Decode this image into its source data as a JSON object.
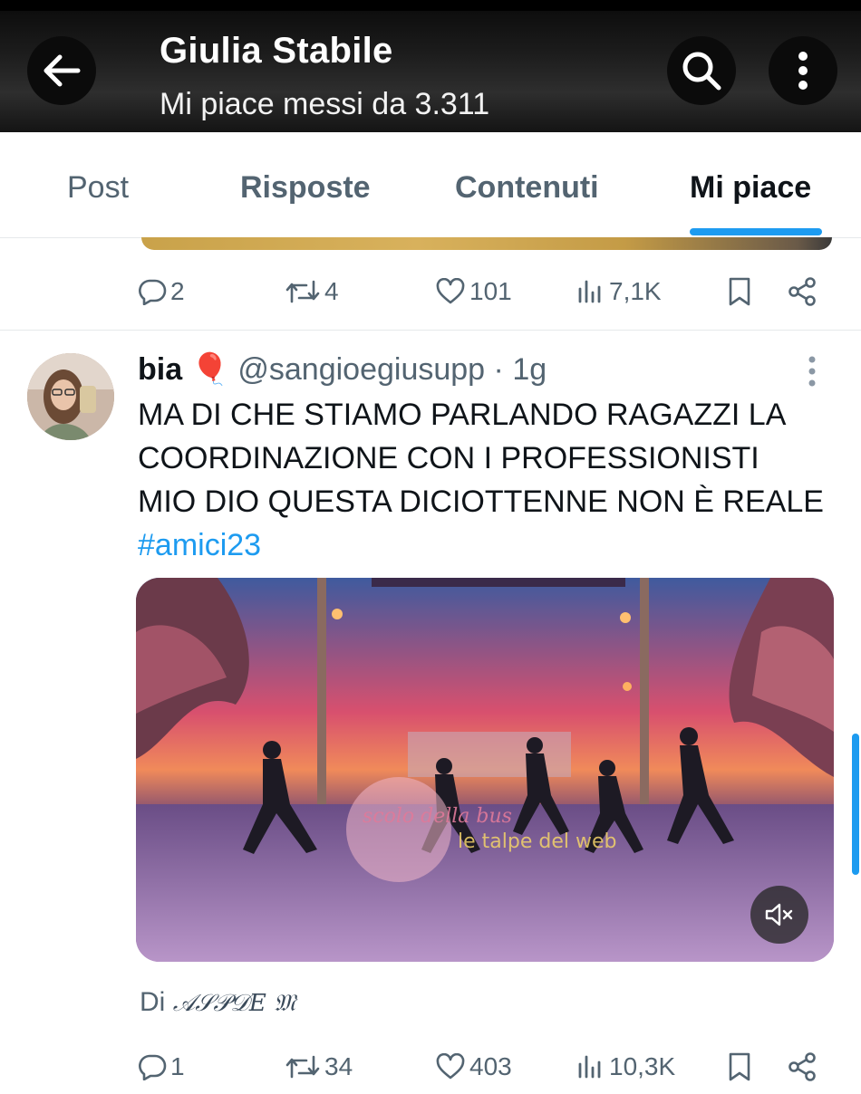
{
  "header": {
    "title": "Giulia Stabile",
    "subtitle": "Mi piace messi da 3.311"
  },
  "tabs": [
    {
      "label": "Post",
      "active": false
    },
    {
      "label": "Risposte",
      "active": false
    },
    {
      "label": "Contenuti",
      "active": false
    },
    {
      "label": "Mi piace",
      "active": true
    }
  ],
  "previous_tweet": {
    "actions": {
      "replies": "2",
      "reposts": "4",
      "likes": "101",
      "views": "7,1K"
    }
  },
  "tweet": {
    "name": "bia",
    "name_emoji": "🎈",
    "handle": "@sangioegiusupp",
    "separator": " · ",
    "time": "1g",
    "text_lines": [
      "MA DI CHE STIAMO PARLANDO RAGAZZI LA",
      "COORDINAZIONE CON I PROFESSIONISTI",
      "MIO DIO QUESTA DICIOTTENNE NON È REALE"
    ],
    "hashtag": "#amici23",
    "media": {
      "watermark_left": "scolo della bus",
      "watermark_right": "le talpe del web"
    },
    "caption_prefix": "Di",
    "caption_name": "𝒜𝒮𝒫𝒟𝐸 𝔐",
    "actions": {
      "replies": "1",
      "reposts": "34",
      "likes": "403",
      "views": "10,3K"
    }
  },
  "colors": {
    "accent": "#1d9bf0",
    "muted": "#536471",
    "text": "#0f1419"
  }
}
